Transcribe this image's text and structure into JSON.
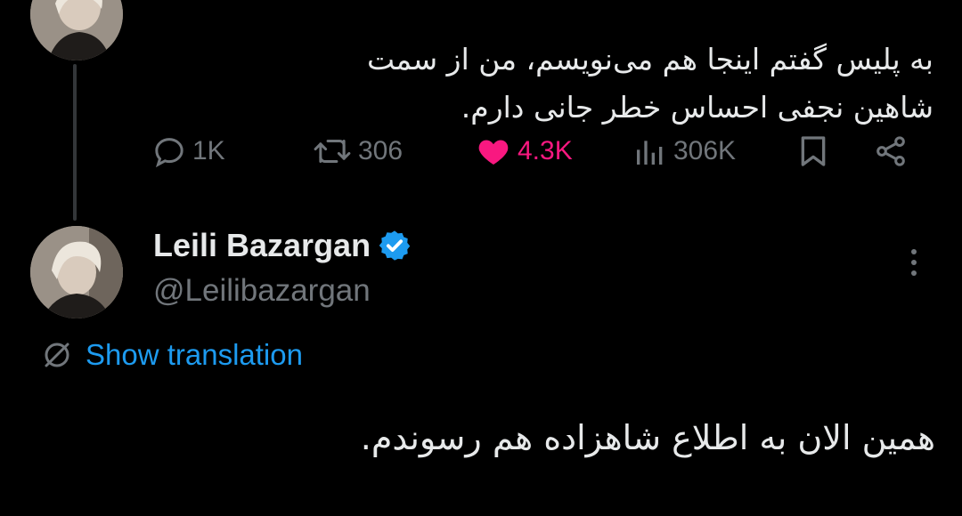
{
  "previous_tweet": {
    "text_line_1": "به پلیس گفتم اینجا هم می‌نویسم، من از سمت",
    "text_line_2": "شاهین نجفی احساس خطر جانی دارم.",
    "actions": {
      "replies": "1K",
      "retweets": "306",
      "likes": "4.3K",
      "views": "306K"
    },
    "like_color": "#f91880"
  },
  "tweet": {
    "author_name": "Leili Bazargan",
    "handle": "@Leilibazargan",
    "verified": true,
    "show_translation_label": "Show translation",
    "text": "همین الان به اطلاع شاهزاده هم رسوندم."
  },
  "colors": {
    "background": "#000000",
    "text": "#e7e9ea",
    "muted": "#71767b",
    "accent": "#1d9bf0"
  },
  "icons": [
    "reply-icon",
    "retweet-icon",
    "heart-icon",
    "views-icon",
    "bookmark-icon",
    "share-icon",
    "verified-badge-icon",
    "more-options-icon",
    "translate-icon"
  ]
}
